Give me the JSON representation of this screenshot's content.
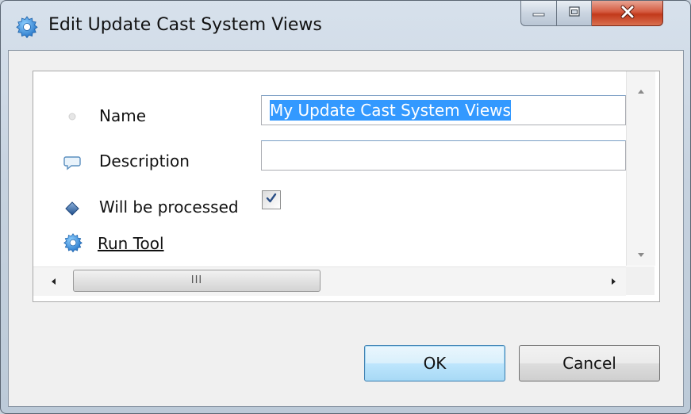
{
  "window": {
    "title": "Edit Update Cast System Views",
    "icon": "gear-icon"
  },
  "form": {
    "name": {
      "label": "Name",
      "value": "My Update Cast System Views",
      "icon": "dot-icon"
    },
    "description": {
      "label": "Description",
      "value": "",
      "icon": "speech-bubble-icon"
    },
    "processed": {
      "label": "Will be processed",
      "checked": true,
      "icon": "diamond-icon"
    },
    "run_tool": {
      "label": "Run Tool",
      "icon": "gear-icon"
    },
    "scrollbar": {
      "thumb_grip": "III"
    }
  },
  "buttons": {
    "ok_label": "OK",
    "cancel_label": "Cancel"
  },
  "colors": {
    "selection": "#3399ff",
    "gear_icon": "#2a7fd4",
    "close_button": "#c2391b"
  }
}
